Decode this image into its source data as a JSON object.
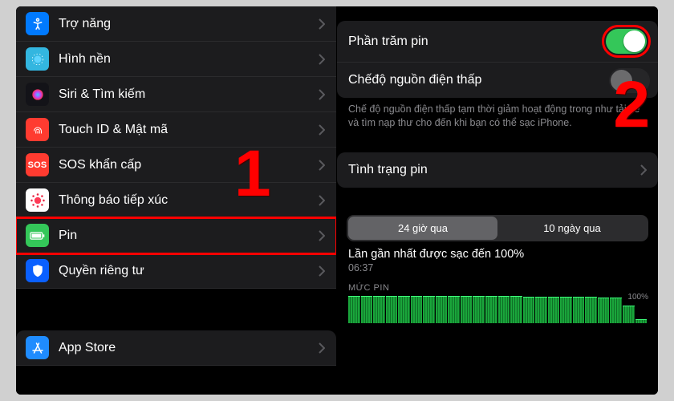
{
  "left": {
    "items": [
      {
        "label": "Trợ năng",
        "icon": "accessibility-icon",
        "color": "ic-blue"
      },
      {
        "label": "Hình nền",
        "icon": "wallpaper-icon",
        "color": "ic-cyan"
      },
      {
        "label": "Siri & Tìm kiếm",
        "icon": "siri-icon",
        "color": "ic-black"
      },
      {
        "label": "Touch ID & Mật mã",
        "icon": "fingerprint-icon",
        "color": "ic-red"
      },
      {
        "label": "SOS khẩn cấp",
        "icon": "sos-icon",
        "color": "ic-redtx",
        "text_icon": "SOS"
      },
      {
        "label": "Thông báo tiếp xúc",
        "icon": "exposure-icon",
        "color": "ic-crim"
      },
      {
        "label": "Pin",
        "icon": "battery-icon",
        "color": "ic-green",
        "highlight": true
      },
      {
        "label": "Quyền riêng tư",
        "icon": "privacy-icon",
        "color": "ic-blue2"
      }
    ],
    "appstore_label": "App Store"
  },
  "right": {
    "percent_label": "Phần trăm pin",
    "percent_on": true,
    "lowpower_label": "Chếđộ nguồn điện thấp",
    "lowpower_on": false,
    "lowpower_note": "Chế độ nguồn điện thấp tạm thời giảm hoạt động trong  như tải về và tìm nạp thư cho đến khi bạn có thể sạc iPhone.",
    "health_label": "Tình trạng pin",
    "seg_24h": "24 giờ qua",
    "seg_10d": "10 ngày qua",
    "last_charge_label": "Lần gần nhất được sạc đến 100%",
    "last_charge_time": "06:37",
    "level_header": "MỨC PIN",
    "pct_label": "100%"
  },
  "annotations": {
    "step1": "1",
    "step2": "2"
  },
  "chart_data": {
    "type": "bar",
    "title": "MỨC PIN",
    "ylabel": "%",
    "ylim": [
      0,
      100
    ],
    "series": [
      {
        "name": "battery-level",
        "values": [
          100,
          100,
          100,
          100,
          100,
          100,
          100,
          100,
          100,
          99,
          99,
          99,
          98,
          98,
          97,
          97,
          96,
          96,
          95,
          95,
          94,
          94,
          63,
          15
        ]
      }
    ]
  }
}
